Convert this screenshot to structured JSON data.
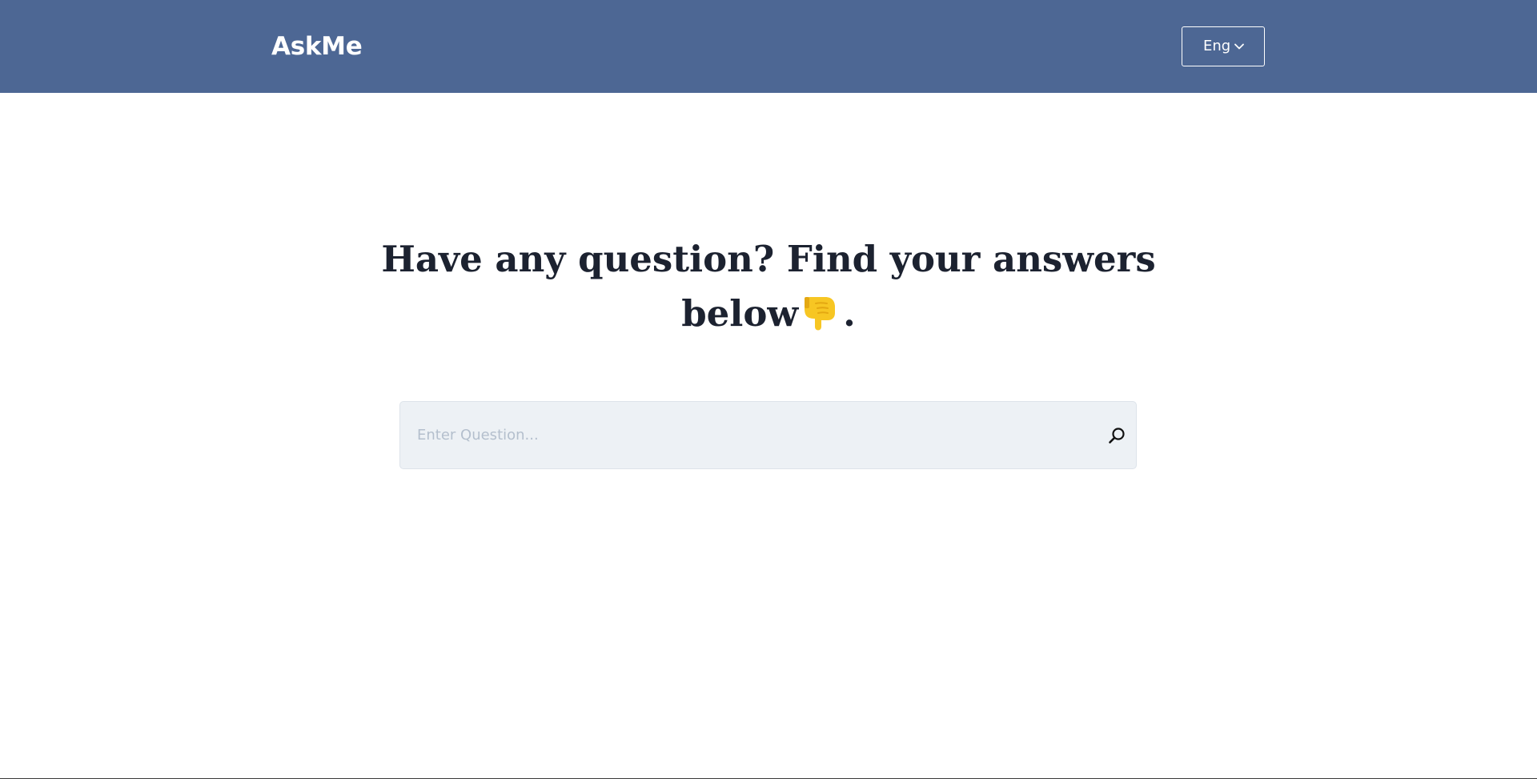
{
  "header": {
    "brand": "AskMe",
    "language": {
      "selected": "Eng",
      "icon": "chevron-down-icon"
    },
    "background_color": "#4d6794"
  },
  "main": {
    "headline_line1": "Have any question? Find your answers",
    "headline_line2": "below",
    "headline_emoji": "pointing-down-hand-icon",
    "headline_end": ".",
    "search": {
      "placeholder": "Enter Question...",
      "value": "",
      "icon": "search-icon"
    }
  },
  "colors": {
    "brand_blue": "#4d6794",
    "heading_text": "#1c2230",
    "search_bg": "#edf1f5",
    "emoji_yellow": "#f7c623"
  }
}
